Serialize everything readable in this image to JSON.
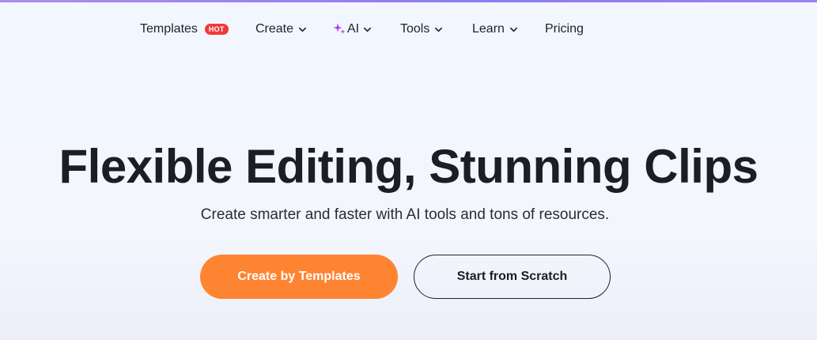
{
  "nav": {
    "templates": {
      "label": "Templates",
      "badge": "HOT",
      "badge_color": "#ef3a3a"
    },
    "create": {
      "label": "Create"
    },
    "ai": {
      "label": "AI",
      "icon_color": "#b43df2"
    },
    "tools": {
      "label": "Tools"
    },
    "learn": {
      "label": "Learn"
    },
    "pricing": {
      "label": "Pricing"
    }
  },
  "hero": {
    "title": "Flexible Editing, Stunning Clips",
    "subtitle": "Create smarter and faster with AI tools and tons of resources.",
    "primary_button": "Create by Templates",
    "secondary_button": "Start from Scratch"
  },
  "colors": {
    "accent": "#ff8431",
    "top_bar": "#8f7bf0",
    "text": "#1b1f24"
  }
}
